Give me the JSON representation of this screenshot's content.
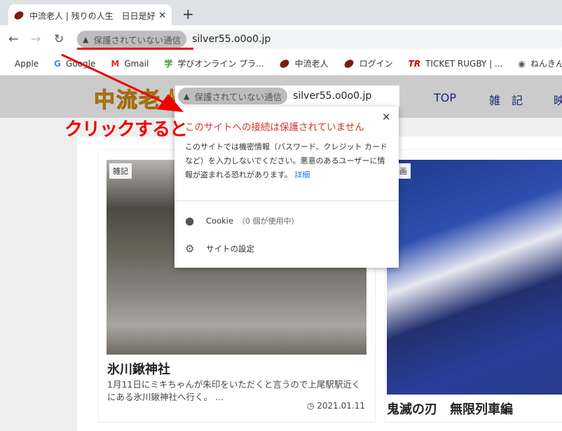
{
  "browser": {
    "tab_title": "中流老人 | 残りの人生　日日是好日",
    "tab_close": "✕",
    "new_tab": "+",
    "security_chip": "保護されていない通信",
    "url": "silver55.o0o0.jp",
    "bookmarks": [
      {
        "icon": "apple-icon",
        "glyph": "",
        "label": "Apple"
      },
      {
        "icon": "google-icon",
        "glyph": "G",
        "label": "Google"
      },
      {
        "icon": "gmail-icon",
        "glyph": "M",
        "label": "Gmail"
      },
      {
        "icon": "manabi-icon",
        "glyph": "学",
        "label": "学びオンライン プラ..."
      },
      {
        "icon": "rugby-ball-icon",
        "glyph": "",
        "label": "中流老人"
      },
      {
        "icon": "rugby-ball-icon",
        "glyph": "",
        "label": "ログイン"
      },
      {
        "icon": "ticket-rugby-icon",
        "glyph": "TR",
        "label": "TICKET RUGBY | ..."
      },
      {
        "icon": "globe-icon",
        "glyph": "◉",
        "label": "ねんきんネ"
      }
    ]
  },
  "site": {
    "logo": "中流老人",
    "menu": [
      "TOP",
      "雑　記",
      "映"
    ]
  },
  "cards": [
    {
      "category": "雑記",
      "title": "氷川鍬神社",
      "excerpt": "1月11日にミキちゃんが朱印をいただくと言うので上尾駅駅近くにある氷川鍬神社へ行く。 …",
      "date": "2021.01.11"
    },
    {
      "category": "映画",
      "title": "鬼滅の刃　無限列車編"
    }
  ],
  "popup": {
    "title": "このサイトへの接続は保護されていません",
    "body": "このサイトでは機密情報（パスワード、クレジット カードなど）を入力しないでください。悪意のあるユーザーに情報が盗まれる恐れがあります。",
    "details_link": "詳細",
    "cookie_label": "Cookie",
    "cookie_count": "（0 個が使用中）",
    "site_settings": "サイトの設定",
    "close": "✕"
  },
  "annotation": {
    "text": "クリックすると",
    "color": "#ee0000"
  }
}
